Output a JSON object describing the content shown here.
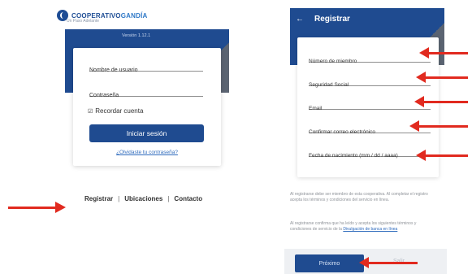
{
  "brand": {
    "name_part1": "COOPERATIVO",
    "name_part2": "GANDÍA",
    "tagline": "Un Paso Adelante",
    "version": "Versión 1.12.1"
  },
  "login": {
    "username_label": "Nombre de usuario",
    "password_label": "Contraseña",
    "remember_label": "Recordar cuenta",
    "login_button": "Iniciar sesión",
    "forgot_link": "¿Olvidaste tu contraseña?"
  },
  "bottom_links": {
    "register": "Registrar",
    "locations": "Ubicaciones",
    "contact": "Contacto",
    "separator": "|"
  },
  "register": {
    "title": "Registrar",
    "fields": [
      "Número de miembro",
      "Seguridad Social",
      "Email",
      "Confirmar correo electrónico",
      "Fecha de nacimiento (mm / dd / aaaa)"
    ],
    "notice_text": "Al registrarse debe ser miembro de esta cooperativa. Al completar el registro acepta los términos y condiciones del servicio en línea.",
    "info_text": "Al registrarse confirma que ha leído y acepta los siguientes términos y condiciones de servicio de la",
    "info_link": "Divulgación de banca en línea",
    "next_button": "Próximo",
    "skip_button": "Salir"
  },
  "colors": {
    "brand_blue": "#1f4b90",
    "arrow_red": "#e12a1f"
  }
}
